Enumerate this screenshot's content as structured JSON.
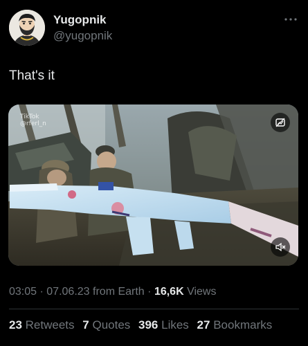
{
  "author": {
    "display_name": "Yugopnik",
    "handle": "@yugopnik",
    "avatar_icon": "cartoon-portrait-avatar"
  },
  "tweet": {
    "text": "That's it"
  },
  "media": {
    "watermark_top": "TikTok",
    "watermark_bottom": "@rferl_n",
    "alt_icon": "alt-text-icon",
    "mute_icon": "speaker-muted-icon"
  },
  "meta": {
    "time": "03:05",
    "date": "07.06.23",
    "source": "from Earth",
    "views_count": "16,6K",
    "views_label": "Views",
    "separator": "·"
  },
  "stats": [
    {
      "count": "23",
      "label": "Retweets"
    },
    {
      "count": "7",
      "label": "Quotes"
    },
    {
      "count": "396",
      "label": "Likes"
    },
    {
      "count": "27",
      "label": "Bookmarks"
    }
  ],
  "colors": {
    "background": "#000000",
    "primary_text": "#e7e9ea",
    "secondary_text": "#71767b",
    "divider": "#2f3336"
  }
}
